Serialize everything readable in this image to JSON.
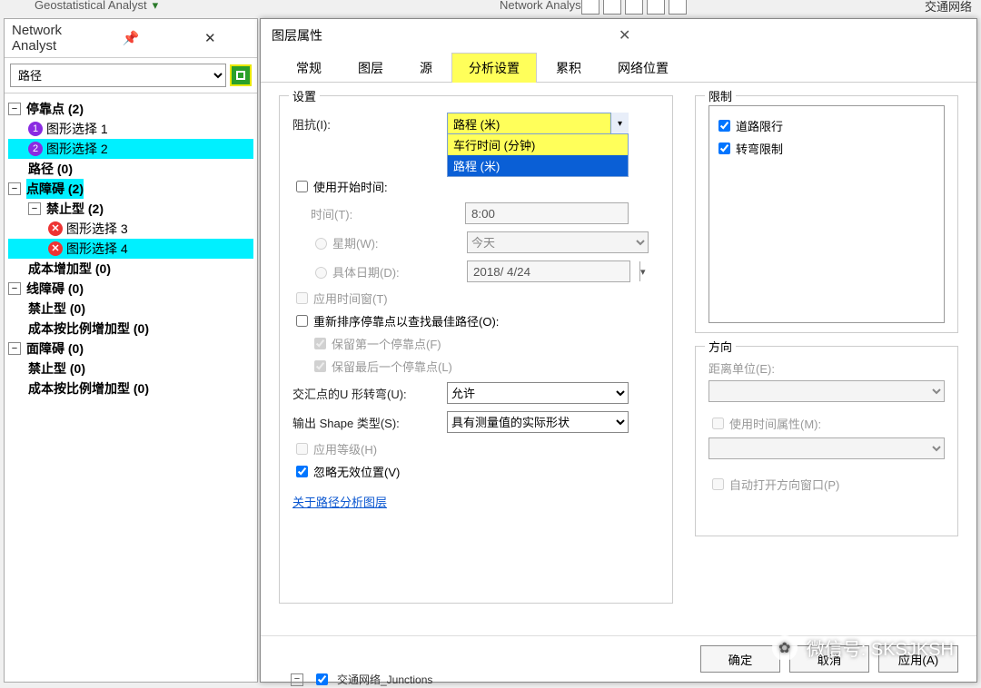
{
  "topbar": {
    "geo": "Geostatistical Analyst",
    "net": "Network Analyst",
    "traffic": "交通网络"
  },
  "panel": {
    "title": "Network Analyst",
    "path_select": "路径",
    "stops": "停靠点 (2)",
    "gsel1": "图形选择 1",
    "gsel2": "图形选择 2",
    "route": "路径 (0)",
    "pointbar": "点障碍 (2)",
    "forbid_type": "禁止型 (2)",
    "gsel3": "图形选择 3",
    "gsel4": "图形选择 4",
    "costadd": "成本增加型 (0)",
    "linebar": "线障碍 (0)",
    "forbid0": "禁止型 (0)",
    "costscale": "成本按比例增加型 (0)",
    "polybar": "面障碍 (0)"
  },
  "dialog": {
    "title": "图层属性",
    "tabs": {
      "general": "常规",
      "layer": "图层",
      "source": "源",
      "analysis": "分析设置",
      "accum": "累积",
      "netloc": "网络位置"
    },
    "settings_title": "设置",
    "impedance_label": "阻抗(I):",
    "impedance_value": "路程 (米)",
    "impedance_opt_time": "车行时间 (分钟)",
    "impedance_opt_dist": "路程 (米)",
    "use_start": "使用开始时间:",
    "time_label": "时间(T):",
    "time_value": "8:00",
    "day_label": "星期(W):",
    "day_value": "今天",
    "date_label": "具体日期(D):",
    "date_value": "2018/ 4/24",
    "time_window": "应用时间窗(T)",
    "reorder": "重新排序停靠点以查找最佳路径(O):",
    "keep_first": "保留第一个停靠点(F)",
    "keep_last": "保留最后一个停靠点(L)",
    "uturn_label": "交汇点的U 形转弯(U):",
    "uturn_value": "允许",
    "shape_label": "输出 Shape 类型(S):",
    "shape_value": "具有测量值的实际形状",
    "hierarchy": "应用等级(H)",
    "ignore_invalid": "忽略无效位置(V)",
    "about_link": "关于路径分析图层",
    "restrict_title": "限制",
    "restrict_road": "道路限行",
    "restrict_turn": "转弯限制",
    "direction_title": "方向",
    "dist_unit": "距离单位(E):",
    "use_time_attr": "使用时间属性(M):",
    "auto_open_dir": "自动打开方向窗口(P)",
    "ok": "确定",
    "cancel": "取消",
    "apply": "应用(A)"
  },
  "watermark": "微信号: SKSJKSH",
  "bottom_frag": "交通网络_Junctions"
}
